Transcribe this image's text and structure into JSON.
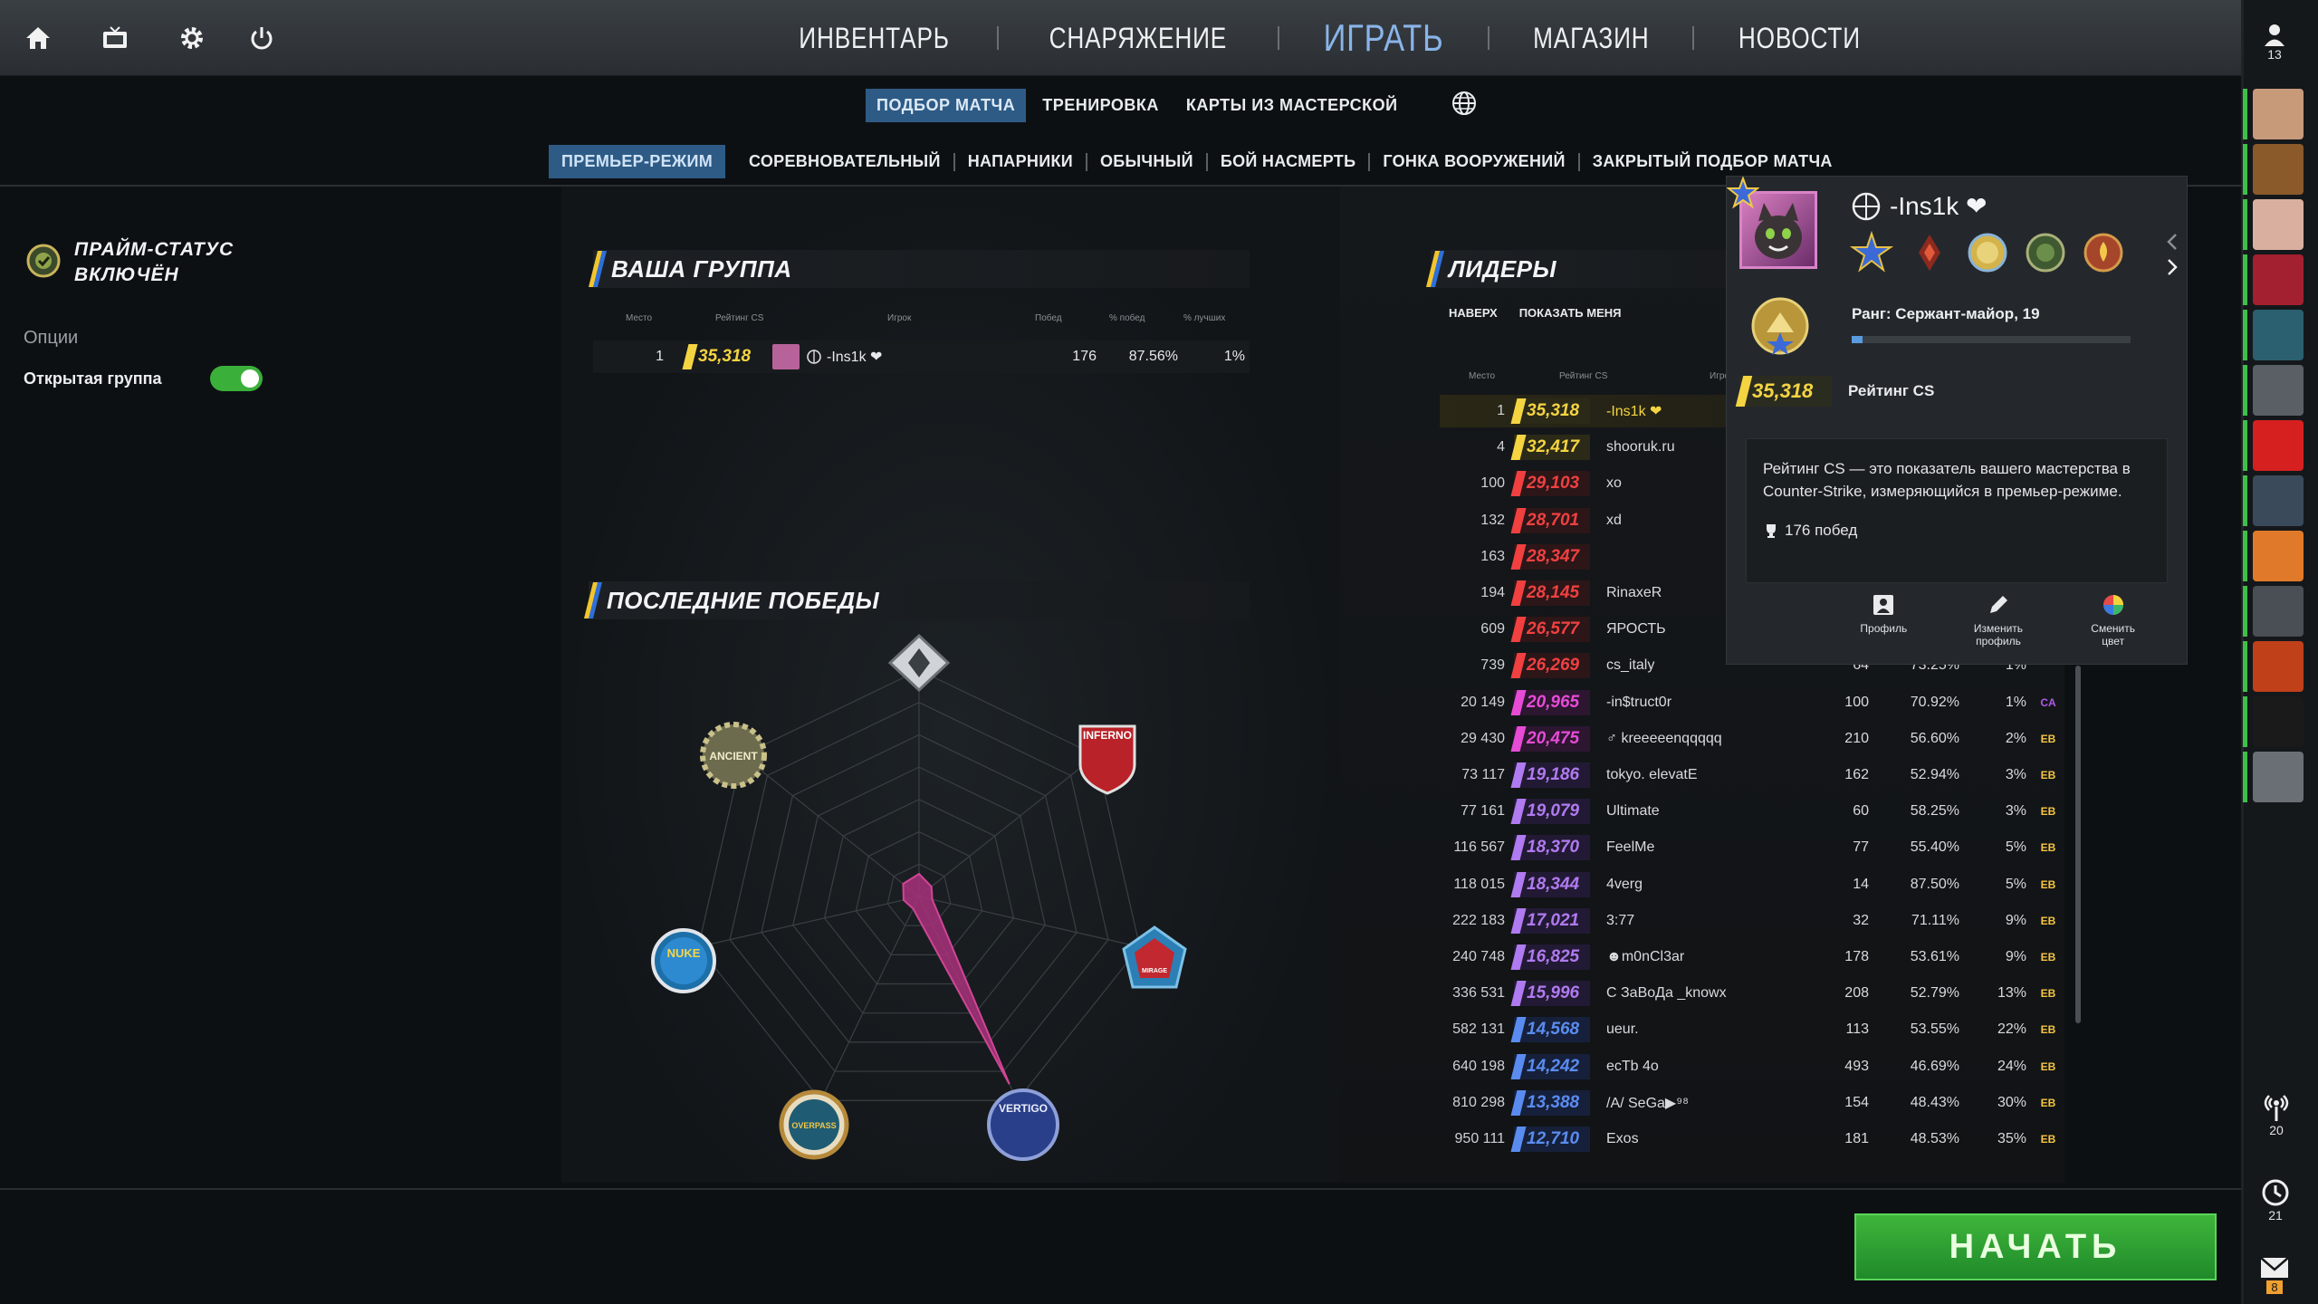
{
  "colors": {
    "accent": "#2e5b85",
    "start_green": "#2a9b30",
    "prime_toggle": "#3ab03a"
  },
  "top": {
    "icons": [
      "home-icon",
      "tv-icon",
      "gear-icon",
      "power-icon"
    ],
    "nav": [
      "ИНВЕНТАРЬ",
      "СНАРЯЖЕНИЕ",
      "ИГРАТЬ",
      "МАГАЗИН",
      "НОВОСТИ"
    ],
    "active": "ИГРАТЬ",
    "friends_count": "13"
  },
  "subnav1": [
    "ПОДБОР МАТЧА",
    "ТРЕНИРОВКА",
    "КАРТЫ ИЗ МАСТЕРСКОЙ"
  ],
  "subnav2": [
    "ПРЕМЬЕР-РЕЖИМ",
    "СОРЕВНОВАТЕЛЬНЫЙ",
    "НАПАРНИКИ",
    "ОБЫЧНЫЙ",
    "БОЙ НАСМЕРТЬ",
    "ГОНКА ВООРУЖЕНИЙ",
    "ЗАКРЫТЫЙ ПОДБОР МАТЧА"
  ],
  "left": {
    "prime_status": "ПРАЙМ-СТАТУС ВКЛЮЧЁН",
    "options": "Опции",
    "open_group": "Открытая группа"
  },
  "group": {
    "title": "ВАША ГРУППА",
    "headers": [
      "Место",
      "Рейтинг CS",
      "Игрок",
      "Побед",
      "% побед",
      "% лучших"
    ],
    "row": {
      "place": "1",
      "rating": "35,318",
      "player": "-Ins1k ❤",
      "wins": "176",
      "winpct": "87.56%",
      "top": "1%"
    }
  },
  "recent": {
    "title": "ПОСЛЕДНИЕ ПОБЕДЫ",
    "maps": [
      "Mirage",
      "Inferno",
      "Ancient",
      "Nuke",
      "Vertigo",
      "Overpass",
      "Anubis"
    ],
    "map_labels": [
      "INFERNO",
      "ANCIENT",
      "NUKE",
      "VERTIGO",
      "OVERPASS",
      "MIRAGE"
    ]
  },
  "leaders": {
    "title": "ЛИДЕРЫ",
    "tabs": [
      "НАВЕРХ",
      "ПОКАЗАТЬ МЕНЯ"
    ],
    "headers": [
      "Место",
      "Рейтинг CS",
      "Игрок"
    ],
    "rows": [
      {
        "place": "1",
        "rating": "35,318",
        "name": "-Ins1k ❤",
        "wins": "",
        "pct": "",
        "top": "",
        "reg": "",
        "tier": "gold",
        "highlight": true
      },
      {
        "place": "4",
        "rating": "32,417",
        "name": "shooruk.ru",
        "wins": "",
        "pct": "",
        "top": "",
        "reg": "",
        "tier": "gold"
      },
      {
        "place": "100",
        "rating": "29,103",
        "name": "xo",
        "wins": "",
        "pct": "",
        "top": "",
        "reg": "",
        "tier": "red"
      },
      {
        "place": "132",
        "rating": "28,701",
        "name": "xd",
        "wins": "",
        "pct": "",
        "top": "",
        "reg": "",
        "tier": "red"
      },
      {
        "place": "163",
        "rating": "28,347",
        "name": "",
        "wins": "",
        "pct": "",
        "top": "",
        "reg": "",
        "tier": "red"
      },
      {
        "place": "194",
        "rating": "28,145",
        "name": "RinaxeR",
        "wins": "",
        "pct": "",
        "top": "",
        "reg": "",
        "tier": "red"
      },
      {
        "place": "609",
        "rating": "26,577",
        "name": "ЯРОСТЬ",
        "wins": "",
        "pct": "",
        "top": "",
        "reg": "",
        "tier": "red"
      },
      {
        "place": "739",
        "rating": "26,269",
        "name": "cs_italy",
        "wins": "64",
        "pct": "73.25%",
        "top": "1%",
        "reg": "",
        "tier": "red"
      },
      {
        "place": "20 149",
        "rating": "20,965",
        "name": "-in$truct0r",
        "wins": "100",
        "pct": "70.92%",
        "top": "1%",
        "reg": "CA",
        "tier": "pink"
      },
      {
        "place": "29 430",
        "rating": "20,475",
        "name": "♂ kreeeeenqqqqq",
        "wins": "210",
        "pct": "56.60%",
        "top": "2%",
        "reg": "EB",
        "tier": "pink"
      },
      {
        "place": "73 117",
        "rating": "19,186",
        "name": "tokyo. elevatE",
        "wins": "162",
        "pct": "52.94%",
        "top": "3%",
        "reg": "EB",
        "tier": "purple"
      },
      {
        "place": "77 161",
        "rating": "19,079",
        "name": "Ultimate",
        "wins": "60",
        "pct": "58.25%",
        "top": "3%",
        "reg": "EB",
        "tier": "purple"
      },
      {
        "place": "116 567",
        "rating": "18,370",
        "name": "FeelMe",
        "wins": "77",
        "pct": "55.40%",
        "top": "5%",
        "reg": "EB",
        "tier": "purple"
      },
      {
        "place": "118 015",
        "rating": "18,344",
        "name": "4verg",
        "wins": "14",
        "pct": "87.50%",
        "top": "5%",
        "reg": "EB",
        "tier": "purple"
      },
      {
        "place": "222 183",
        "rating": "17,021",
        "name": "3:77",
        "wins": "32",
        "pct": "71.11%",
        "top": "9%",
        "reg": "EB",
        "tier": "purple"
      },
      {
        "place": "240 748",
        "rating": "16,825",
        "name": "☻m0nCl3ar",
        "wins": "178",
        "pct": "53.61%",
        "top": "9%",
        "reg": "EB",
        "tier": "purple"
      },
      {
        "place": "336 531",
        "rating": "15,996",
        "name": "С ЗаВоДа _knowx",
        "wins": "208",
        "pct": "52.79%",
        "top": "13%",
        "reg": "EB",
        "tier": "purple"
      },
      {
        "place": "582 131",
        "rating": "14,568",
        "name": "ueur.",
        "wins": "113",
        "pct": "53.55%",
        "top": "22%",
        "reg": "EB",
        "tier": "blue"
      },
      {
        "place": "640 198",
        "rating": "14,242",
        "name": "ecTb 4o",
        "wins": "493",
        "pct": "46.69%",
        "top": "24%",
        "reg": "EB",
        "tier": "blue"
      },
      {
        "place": "810 298",
        "rating": "13,388",
        "name": "/A/ SeGa▶⁹⁸",
        "wins": "154",
        "pct": "48.43%",
        "top": "30%",
        "reg": "EB",
        "tier": "blue"
      },
      {
        "place": "950 111",
        "rating": "12,710",
        "name": "Exos",
        "wins": "181",
        "pct": "48.53%",
        "top": "35%",
        "reg": "EB",
        "tier": "blue"
      }
    ]
  },
  "popup": {
    "name": "-Ins1k ❤",
    "rank": "Ранг: Сержант-майор, 19",
    "rating_value": "35,318",
    "rating_label": "Рейтинг CS",
    "rank_progress": 0.04,
    "tooltip": "Рейтинг CS — это показатель вашего мастерства в Counter-Strike, измеряющийся в премьер-режиме.",
    "wins": "176 побед",
    "actions": [
      "Профиль",
      "Изменить профиль",
      "Сменить цвет"
    ]
  },
  "sidebar": {
    "radio_count": "20",
    "history_count": "21",
    "mail_count": "8"
  },
  "start_label": "НАЧАТЬ"
}
